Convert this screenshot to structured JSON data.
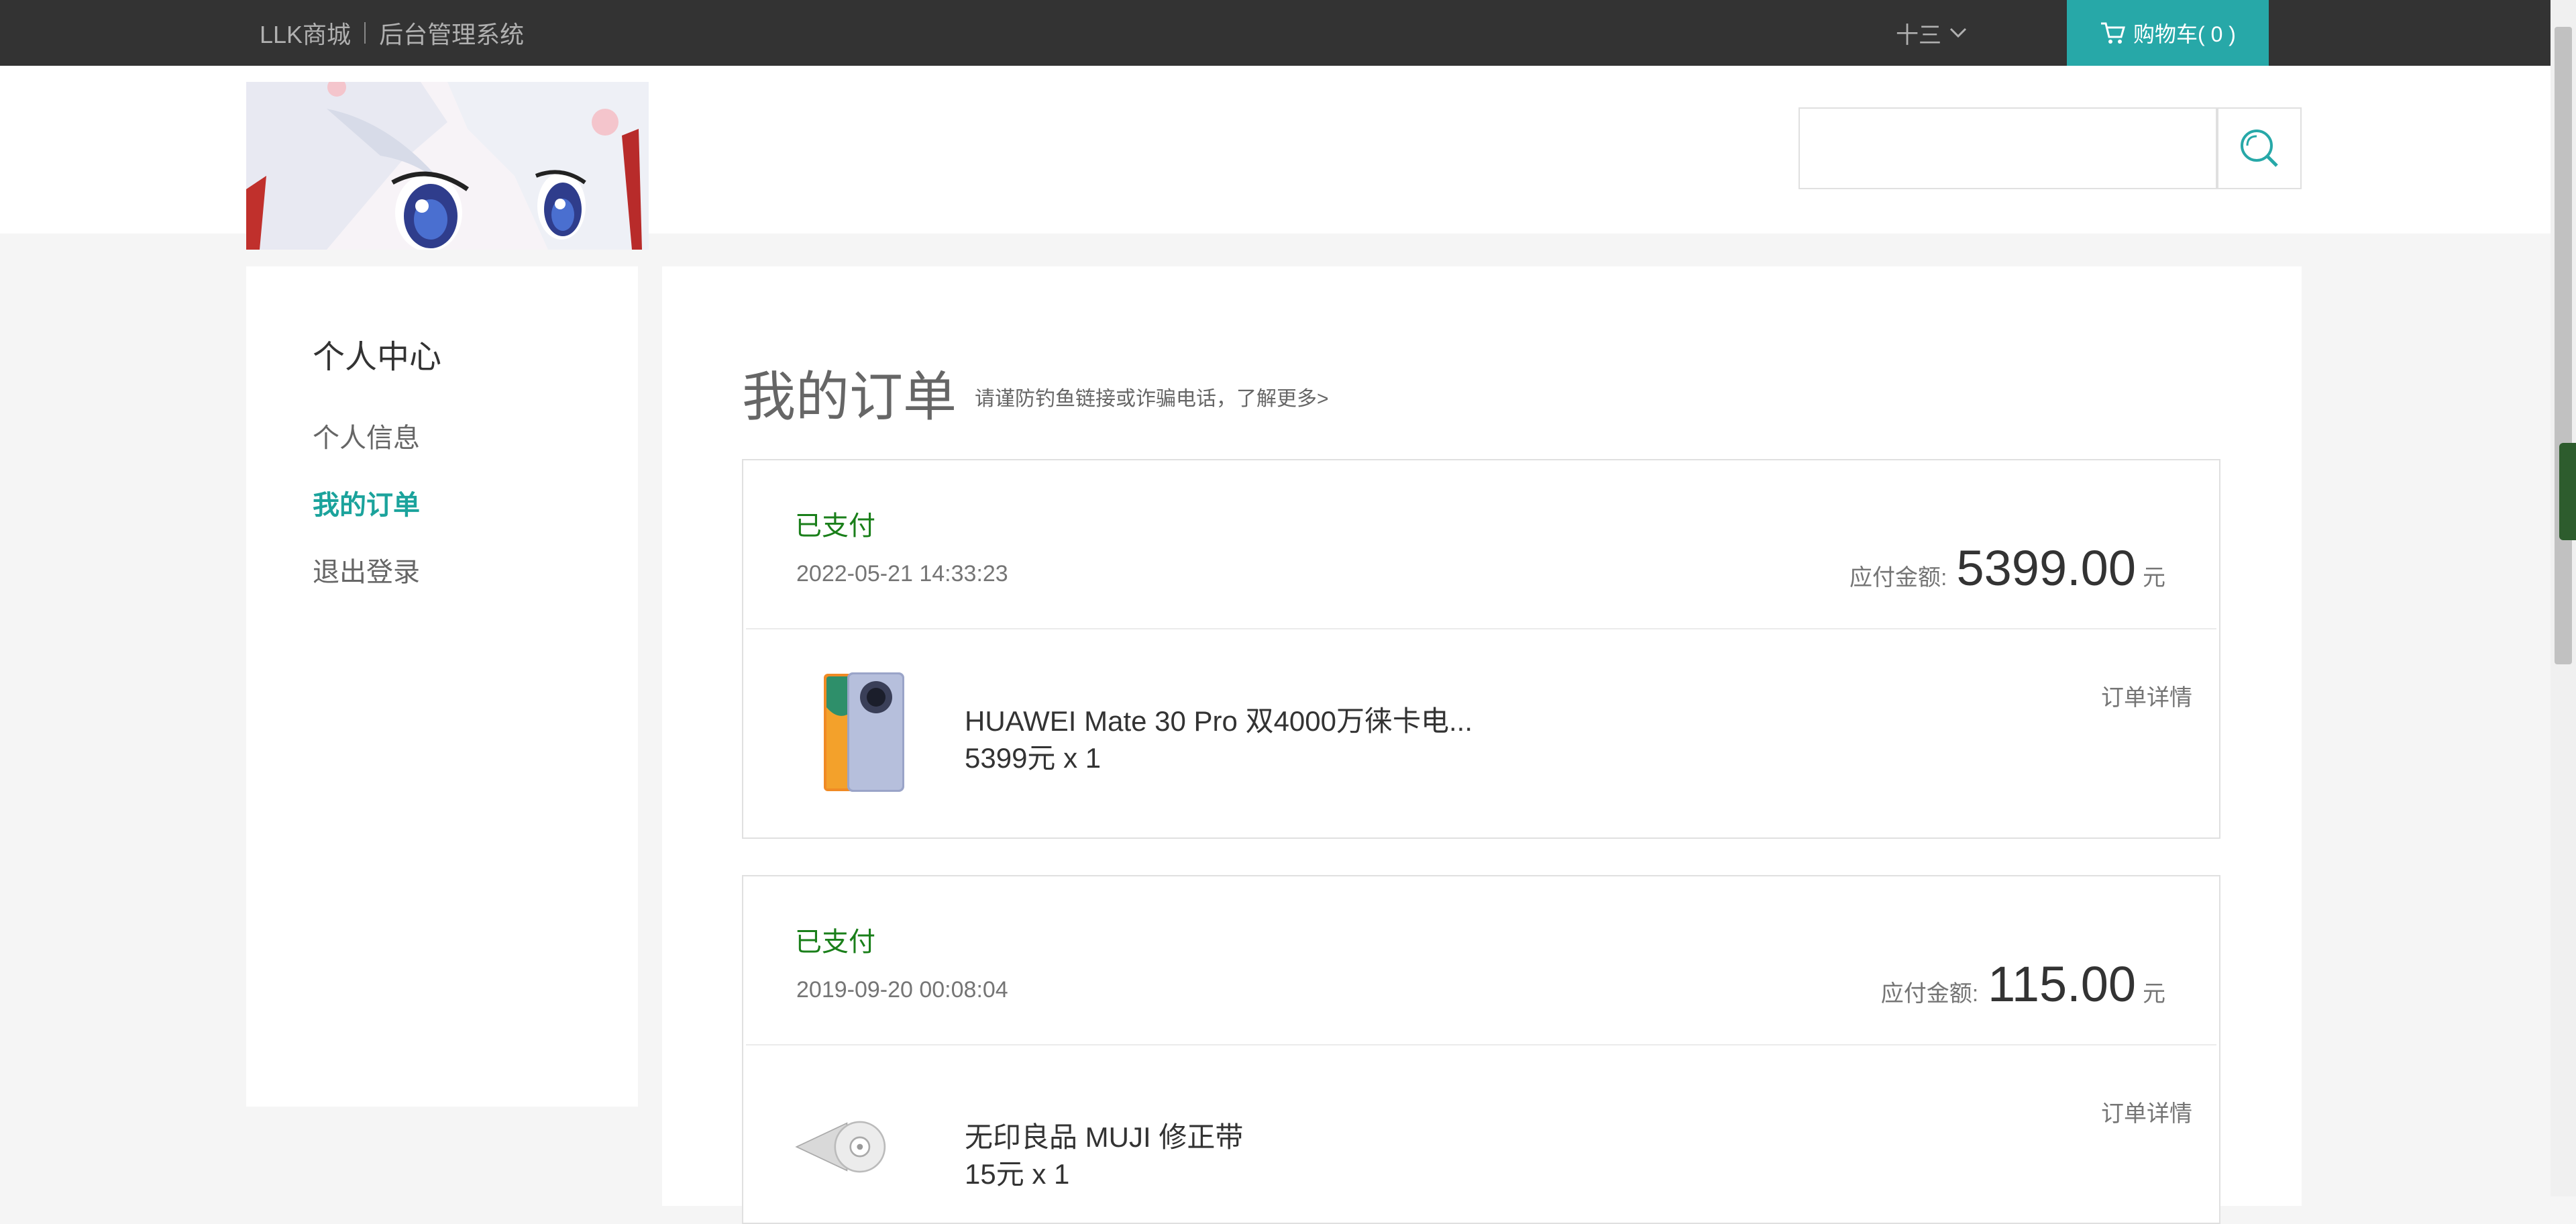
{
  "topbar": {
    "link1": "LLK商城",
    "link2": "后台管理系统",
    "user_name": "十三",
    "cart_label": "购物车( 0 )"
  },
  "search": {
    "placeholder": ""
  },
  "sidebar": {
    "title": "个人中心",
    "items": [
      {
        "label": "个人信息"
      },
      {
        "label": "我的订单",
        "active": true
      },
      {
        "label": "退出登录"
      }
    ]
  },
  "main": {
    "title": "我的订单",
    "subtitle": "请谨防钓鱼链接或诈骗电话，了解更多>"
  },
  "orders": [
    {
      "status": "已支付",
      "time": "2022-05-21 14:33:23",
      "amount_label": "应付金额:",
      "amount": "5399.00",
      "unit": "元",
      "product_name": "HUAWEI Mate 30 Pro 双4000万徕卡电...",
      "product_price": "5399元 x 1",
      "detail_link": "订单详情"
    },
    {
      "status": "已支付",
      "time": "2019-09-20 00:08:04",
      "amount_label": "应付金额:",
      "amount": "115.00",
      "unit": "元",
      "product_name": "无印良品 MUJI 修正带",
      "product_price": "15元 x 1",
      "detail_link": "订单详情"
    }
  ],
  "colors": {
    "topbar": "#333333",
    "accent": "#27a8a8",
    "active_nav": "#1ba39c",
    "status_paid": "#1a7f1a"
  }
}
